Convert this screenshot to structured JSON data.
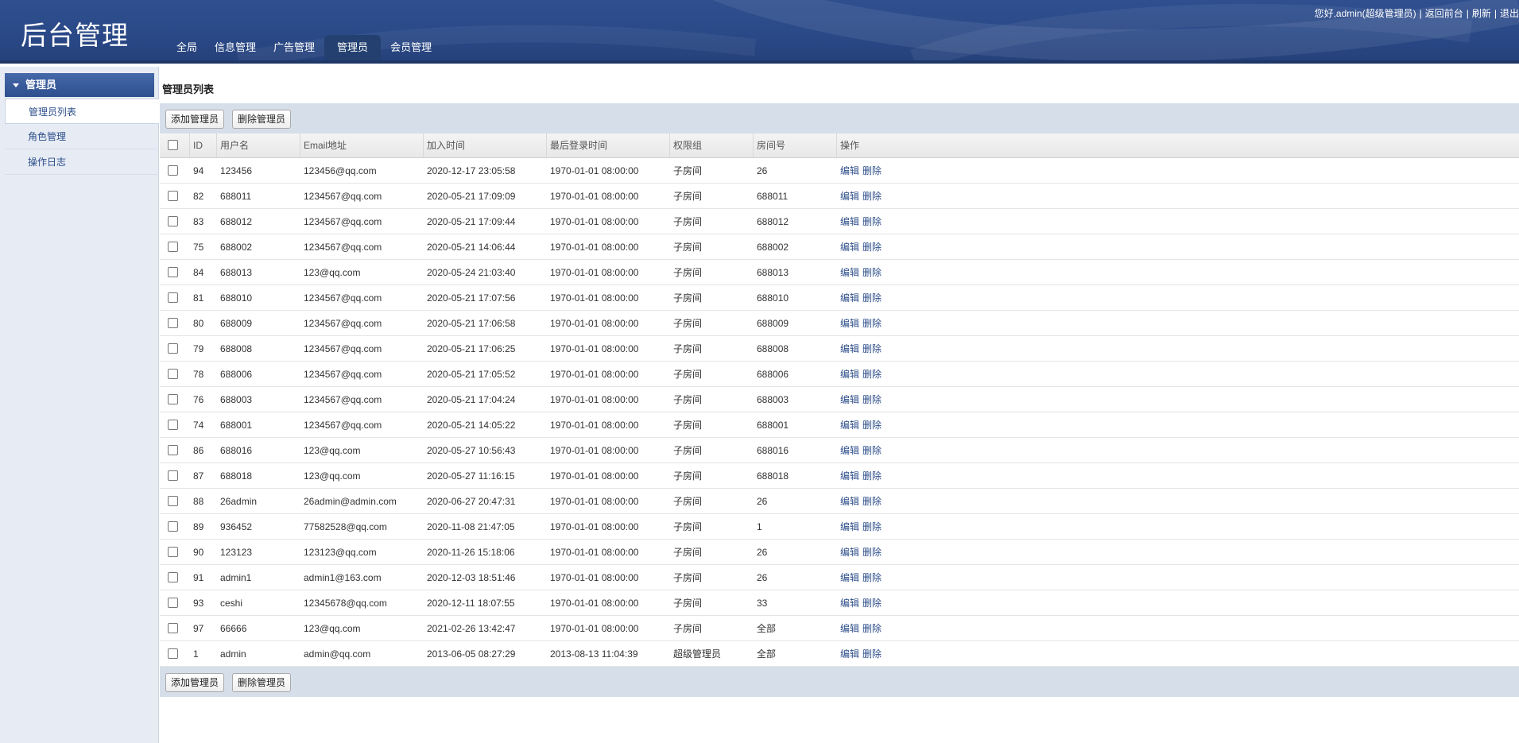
{
  "header": {
    "logo": "后台管理",
    "nav": [
      "全局",
      "信息管理",
      "广告管理",
      "管理员",
      "会员管理"
    ],
    "active_nav": 3,
    "greeting": "您好,admin(超级管理员)",
    "links": [
      "返回前台",
      "刷新",
      "退出"
    ]
  },
  "sidebar": {
    "section": "管理员",
    "items": [
      "管理员列表",
      "角色管理",
      "操作日志"
    ],
    "active_item": 0
  },
  "main": {
    "title": "管理员列表",
    "add_button": "添加管理员",
    "delete_button": "删除管理员",
    "columns": [
      "ID",
      "用户名",
      "Email地址",
      "加入时间",
      "最后登录时间",
      "权限组",
      "房间号",
      "操作"
    ],
    "edit_label": "编辑",
    "remove_label": "删除",
    "rows": [
      {
        "id": "94",
        "user": "123456",
        "email": "123456@qq.com",
        "join": "2020-12-17 23:05:58",
        "last": "1970-01-01 08:00:00",
        "group": "子房间",
        "room": "26"
      },
      {
        "id": "82",
        "user": "688011",
        "email": "1234567@qq.com",
        "join": "2020-05-21 17:09:09",
        "last": "1970-01-01 08:00:00",
        "group": "子房间",
        "room": "688011"
      },
      {
        "id": "83",
        "user": "688012",
        "email": "1234567@qq.com",
        "join": "2020-05-21 17:09:44",
        "last": "1970-01-01 08:00:00",
        "group": "子房间",
        "room": "688012"
      },
      {
        "id": "75",
        "user": "688002",
        "email": "1234567@qq.com",
        "join": "2020-05-21 14:06:44",
        "last": "1970-01-01 08:00:00",
        "group": "子房间",
        "room": "688002"
      },
      {
        "id": "84",
        "user": "688013",
        "email": "123@qq.com",
        "join": "2020-05-24 21:03:40",
        "last": "1970-01-01 08:00:00",
        "group": "子房间",
        "room": "688013"
      },
      {
        "id": "81",
        "user": "688010",
        "email": "1234567@qq.com",
        "join": "2020-05-21 17:07:56",
        "last": "1970-01-01 08:00:00",
        "group": "子房间",
        "room": "688010"
      },
      {
        "id": "80",
        "user": "688009",
        "email": "1234567@qq.com",
        "join": "2020-05-21 17:06:58",
        "last": "1970-01-01 08:00:00",
        "group": "子房间",
        "room": "688009"
      },
      {
        "id": "79",
        "user": "688008",
        "email": "1234567@qq.com",
        "join": "2020-05-21 17:06:25",
        "last": "1970-01-01 08:00:00",
        "group": "子房间",
        "room": "688008"
      },
      {
        "id": "78",
        "user": "688006",
        "email": "1234567@qq.com",
        "join": "2020-05-21 17:05:52",
        "last": "1970-01-01 08:00:00",
        "group": "子房间",
        "room": "688006"
      },
      {
        "id": "76",
        "user": "688003",
        "email": "1234567@qq.com",
        "join": "2020-05-21 17:04:24",
        "last": "1970-01-01 08:00:00",
        "group": "子房间",
        "room": "688003"
      },
      {
        "id": "74",
        "user": "688001",
        "email": "1234567@qq.com",
        "join": "2020-05-21 14:05:22",
        "last": "1970-01-01 08:00:00",
        "group": "子房间",
        "room": "688001"
      },
      {
        "id": "86",
        "user": "688016",
        "email": "123@qq.com",
        "join": "2020-05-27 10:56:43",
        "last": "1970-01-01 08:00:00",
        "group": "子房间",
        "room": "688016"
      },
      {
        "id": "87",
        "user": "688018",
        "email": "123@qq.com",
        "join": "2020-05-27 11:16:15",
        "last": "1970-01-01 08:00:00",
        "group": "子房间",
        "room": "688018"
      },
      {
        "id": "88",
        "user": "26admin",
        "email": "26admin@admin.com",
        "join": "2020-06-27 20:47:31",
        "last": "1970-01-01 08:00:00",
        "group": "子房间",
        "room": "26"
      },
      {
        "id": "89",
        "user": "936452",
        "email": "77582528@qq.com",
        "join": "2020-11-08 21:47:05",
        "last": "1970-01-01 08:00:00",
        "group": "子房间",
        "room": "1"
      },
      {
        "id": "90",
        "user": "123123",
        "email": "123123@qq.com",
        "join": "2020-11-26 15:18:06",
        "last": "1970-01-01 08:00:00",
        "group": "子房间",
        "room": "26"
      },
      {
        "id": "91",
        "user": "admin1",
        "email": "admin1@163.com",
        "join": "2020-12-03 18:51:46",
        "last": "1970-01-01 08:00:00",
        "group": "子房间",
        "room": "26"
      },
      {
        "id": "93",
        "user": "ceshi",
        "email": "12345678@qq.com",
        "join": "2020-12-11 18:07:55",
        "last": "1970-01-01 08:00:00",
        "group": "子房间",
        "room": "33"
      },
      {
        "id": "97",
        "user": "66666",
        "email": "123@qq.com",
        "join": "2021-02-26 13:42:47",
        "last": "1970-01-01 08:00:00",
        "group": "子房间",
        "room": "全部"
      },
      {
        "id": "1",
        "user": "admin",
        "email": "admin@qq.com",
        "join": "2013-06-05 08:27:29",
        "last": "2013-08-13 11:04:39",
        "group": "超级管理员",
        "room": "全部"
      }
    ]
  }
}
